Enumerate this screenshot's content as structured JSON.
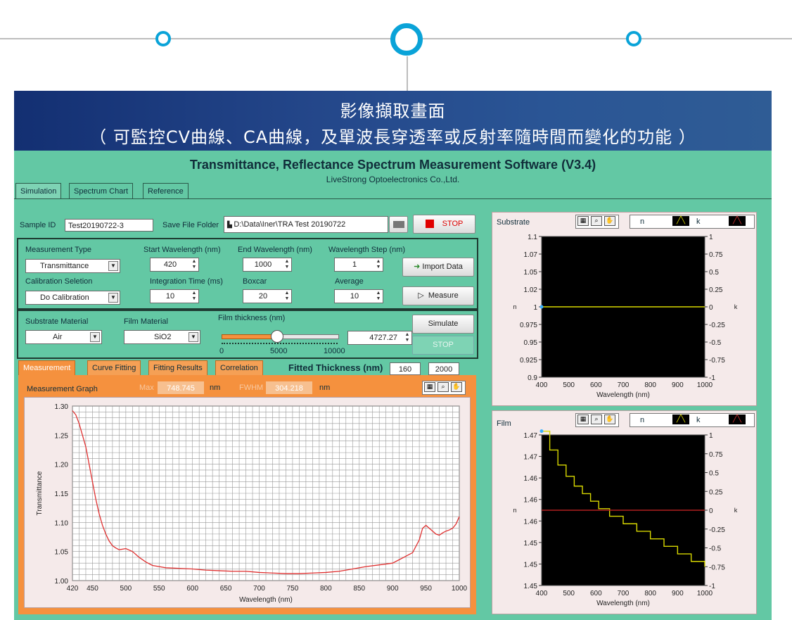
{
  "banner": {
    "title": "影像擷取畫面",
    "subtitle": "（ 可監控CV曲線、CA曲線，及單波長穿透率或反射率隨時間而變化的功能 ）"
  },
  "app": {
    "title": "Transmittance, Reflectance Spectrum Measurement Software (V3.4)",
    "company": "LiveStrong Optoelectronics Co.,Ltd.",
    "tabs": [
      "Simulation",
      "Spectrum Chart",
      "Reference"
    ],
    "sample_id_label": "Sample ID",
    "sample_id": "Test20190722-3",
    "save_folder_label": "Save File Folder",
    "save_folder": "D:\\Data\\Iner\\TRA Test 20190722",
    "stop_label": "STOP",
    "measurement_type_label": "Measurement Type",
    "measurement_type": "Transmittance",
    "start_wl_label": "Start Wavelength (nm)",
    "start_wl": "420",
    "end_wl_label": "End Wavelength (nm)",
    "end_wl": "1000",
    "wl_step_label": "Wavelength Step (nm)",
    "wl_step": "1",
    "import_label": "Import Data",
    "calibration_label": "Calibration Selection",
    "calibration_label_shown": "Calibration Seletion",
    "calibration": "Do Calibration",
    "integration_label": "Integration Time (ms)",
    "integration": "10",
    "boxcar_label": "Boxcar",
    "boxcar": "20",
    "average_label": "Average",
    "average": "10",
    "measure_label": "Measure",
    "substrate_material_label": "Substrate Material",
    "substrate_material": "Air",
    "film_material_label": "Film Material",
    "film_material": "SiO2",
    "film_thickness_label": "Film thickness (nm)",
    "film_thickness_value": "4727.27",
    "film_thickness_fraction": 0.47,
    "slider_ticks": [
      "0",
      "5000",
      "10000"
    ],
    "simulate_label": "Simulate",
    "stop2_label": "STOP",
    "bottom_tabs": [
      "Measurement",
      "Curve Fitting",
      "Fitting Results",
      "Correlation"
    ],
    "fitted_label": "Fitted Thickness (nm)",
    "fitted_min": "160",
    "fitted_max": "2000",
    "graph_title": "Measurement Graph",
    "max_label": "Max",
    "max_value": "748.745",
    "max_unit": "nm",
    "fwhm_label": "FWHM",
    "fwhm_value": "304.218",
    "fwhm_unit": "nm",
    "substrate_panel_title": "Substrate",
    "film_panel_title": "Film",
    "legend_n": "n",
    "legend_k": "k",
    "colors": {
      "background": "#63c8a4",
      "orange": "#f5913e",
      "banner": "#24478a",
      "plot_line": "#e03030",
      "nk_line": "#d8d800",
      "k_line": "#b02020"
    }
  },
  "chart_data": [
    {
      "type": "line",
      "title": "Measurement Graph",
      "xlabel": "Wavelength (nm)",
      "ylabel": "Transmittance",
      "xlim": [
        420,
        1000
      ],
      "ylim": [
        1.0,
        1.3
      ],
      "xticks": [
        420,
        450,
        500,
        550,
        600,
        650,
        700,
        750,
        800,
        850,
        900,
        950,
        1000
      ],
      "yticks": [
        "1.00",
        "1.05",
        "1.10",
        "1.15",
        "1.20",
        "1.25",
        "1.30"
      ],
      "series": [
        {
          "x": [
            420,
            425,
            430,
            435,
            440,
            445,
            450,
            455,
            460,
            465,
            470,
            475,
            480,
            485,
            490,
            500,
            510,
            520,
            530,
            540,
            550,
            560,
            580,
            600,
            620,
            640,
            660,
            680,
            700,
            720,
            740,
            760,
            780,
            800,
            820,
            840,
            860,
            880,
            900,
            910,
            920,
            930,
            940,
            945,
            950,
            955,
            960,
            965,
            970,
            975,
            980,
            985,
            990,
            995,
            1000
          ],
          "values": [
            1.292,
            1.285,
            1.27,
            1.25,
            1.23,
            1.2,
            1.17,
            1.14,
            1.115,
            1.095,
            1.08,
            1.068,
            1.06,
            1.056,
            1.053,
            1.055,
            1.05,
            1.04,
            1.032,
            1.026,
            1.024,
            1.022,
            1.021,
            1.02,
            1.018,
            1.017,
            1.016,
            1.016,
            1.014,
            1.013,
            1.012,
            1.012,
            1.013,
            1.014,
            1.016,
            1.02,
            1.024,
            1.027,
            1.03,
            1.036,
            1.042,
            1.048,
            1.07,
            1.09,
            1.095,
            1.09,
            1.085,
            1.08,
            1.078,
            1.082,
            1.085,
            1.087,
            1.09,
            1.097,
            1.11
          ]
        }
      ]
    },
    {
      "type": "line",
      "title": "Substrate",
      "xlabel": "Wavelength (nm)",
      "ylabel": "n",
      "y2label": "k",
      "xlim": [
        400,
        1000
      ],
      "ylim": [
        0.9,
        1.1
      ],
      "xticks": [
        400,
        500,
        600,
        700,
        800,
        900,
        1000
      ],
      "yticks": [
        "0.9",
        "0.925",
        "0.95",
        "0.975",
        "1",
        "1.02",
        "1.05",
        "1.07",
        "1.1"
      ],
      "y2ticks": [
        "-1",
        "-0.75",
        "-0.5",
        "-0.25",
        "0",
        "0.25",
        "0.5",
        "0.75",
        "1"
      ],
      "series": [
        {
          "name": "n",
          "x": [
            400,
            1000
          ],
          "values": [
            1.0,
            1.0
          ]
        }
      ]
    },
    {
      "type": "line",
      "title": "Film",
      "xlabel": "Wavelength (nm)",
      "ylabel": "n",
      "y2label": "k",
      "xlim": [
        400,
        1000
      ],
      "ylim": [
        1.45,
        1.47
      ],
      "xticks": [
        400,
        500,
        600,
        700,
        800,
        900,
        1000
      ],
      "yticks": [
        "1.45",
        "1.45",
        "1.45",
        "1.46",
        "1.46",
        "1.46",
        "1.47",
        "1.47"
      ],
      "y2ticks": [
        "-1",
        "-0.75",
        "-0.5",
        "-0.25",
        "0",
        "0.25",
        "0.5",
        "0.75",
        "1"
      ],
      "series": [
        {
          "name": "n",
          "x": [
            400,
            430,
            460,
            490,
            520,
            550,
            580,
            610,
            650,
            700,
            750,
            800,
            850,
            900,
            950,
            1000
          ],
          "values": [
            1.4705,
            1.468,
            1.466,
            1.4645,
            1.4632,
            1.4622,
            1.4612,
            1.4602,
            1.4592,
            1.4582,
            1.4572,
            1.4562,
            1.4552,
            1.4542,
            1.4532,
            1.4525
          ]
        },
        {
          "name": "k",
          "x": [
            400,
            1000
          ],
          "values": [
            0,
            0
          ]
        }
      ]
    }
  ]
}
